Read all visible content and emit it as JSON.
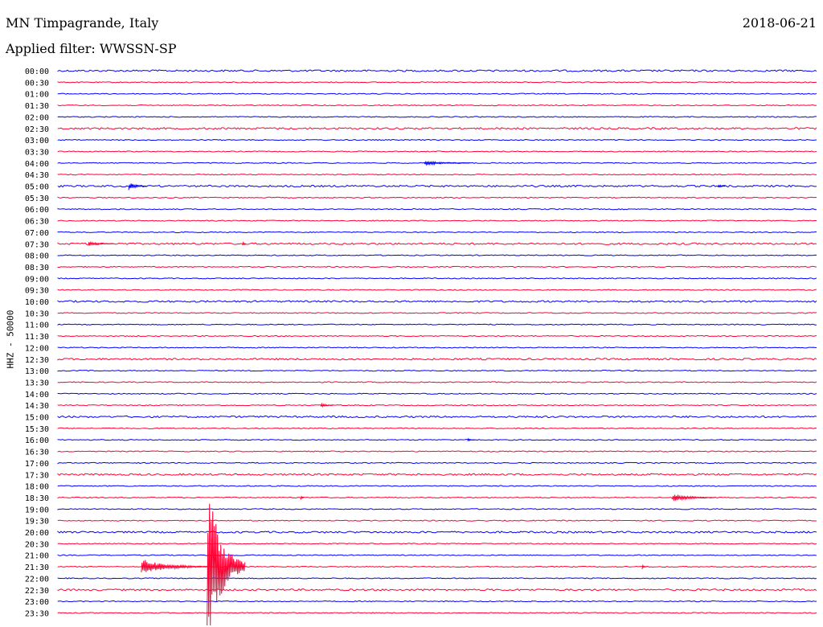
{
  "header": {
    "station": "MN Timpagrande, Italy",
    "filter": "Applied filter: WWSSN-SP",
    "date": "2018-06-21"
  },
  "chart_data": {
    "type": "line",
    "title": "MN Timpagrande, Italy",
    "subtitle": "Applied filter: WWSSN-SP",
    "date": "2018-06-21",
    "ylabel": "HHZ - 50000",
    "colors": {
      "even_row": "#0000ff",
      "odd_row": "#ff0033",
      "text": "#000000"
    },
    "rows": [
      "00:00",
      "00:30",
      "01:00",
      "01:30",
      "02:00",
      "02:30",
      "03:00",
      "03:30",
      "04:00",
      "04:30",
      "05:00",
      "05:30",
      "06:00",
      "06:30",
      "07:00",
      "07:30",
      "08:00",
      "08:30",
      "09:00",
      "09:30",
      "10:00",
      "10:30",
      "11:00",
      "11:30",
      "12:00",
      "12:30",
      "13:00",
      "13:30",
      "14:00",
      "14:30",
      "15:00",
      "15:30",
      "16:00",
      "16:30",
      "17:00",
      "17:30",
      "18:00",
      "18:30",
      "19:00",
      "19:30",
      "20:00",
      "20:30",
      "21:00",
      "21:30",
      "22:00",
      "22:30",
      "23:00",
      "23:30"
    ],
    "events": [
      {
        "row": "04:00",
        "minute": 14.5,
        "amplitude": 3,
        "duration_min": 1.8
      },
      {
        "row": "05:00",
        "minute": 2.8,
        "amplitude": 5,
        "duration_min": 0.7
      },
      {
        "row": "05:00",
        "minute": 26.1,
        "amplitude": 3,
        "duration_min": 0.3
      },
      {
        "row": "07:30",
        "minute": 1.2,
        "amplitude": 3,
        "duration_min": 1.0
      },
      {
        "row": "07:30",
        "minute": 7.3,
        "amplitude": 4,
        "duration_min": 0.1
      },
      {
        "row": "14:30",
        "minute": 10.4,
        "amplitude": 3,
        "duration_min": 0.5
      },
      {
        "row": "16:00",
        "minute": 16.2,
        "amplitude": 2,
        "duration_min": 0.3
      },
      {
        "row": "18:30",
        "minute": 9.6,
        "amplitude": 4,
        "duration_min": 0.1
      },
      {
        "row": "18:30",
        "minute": 24.3,
        "amplitude": 5,
        "duration_min": 1.7
      },
      {
        "row": "21:30",
        "minute": 3.3,
        "amplitude": 10,
        "duration_min": 2.8
      },
      {
        "row": "21:30",
        "minute": 5.9,
        "amplitude": 110,
        "duration_min": 1.5
      },
      {
        "row": "21:30",
        "minute": 23.1,
        "amplitude": 4,
        "duration_min": 0.2
      }
    ]
  }
}
